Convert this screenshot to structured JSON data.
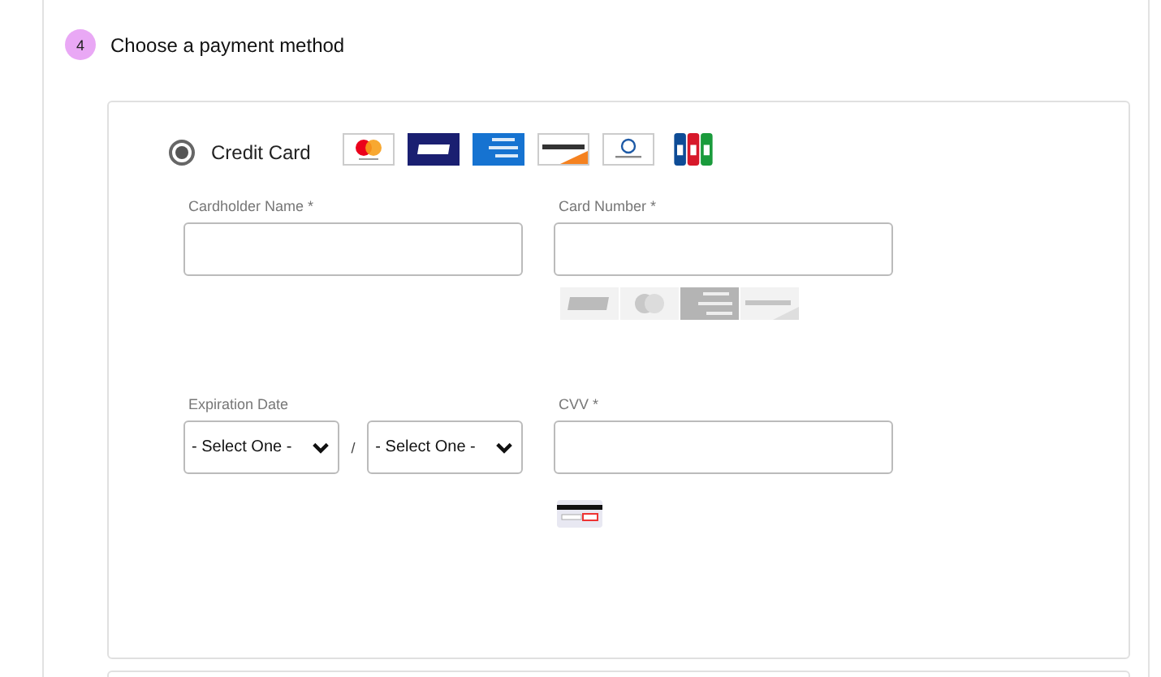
{
  "step": {
    "number": "4",
    "title": "Choose a payment method"
  },
  "payment_method": {
    "label": "Credit Card",
    "selected": true
  },
  "cardholder_name": {
    "label": "Cardholder Name *"
  },
  "card_number": {
    "label": "Card Number *"
  },
  "expiration": {
    "label": "Expiration Date",
    "separator": "/",
    "selects": [
      {
        "value": "- Select One -"
      },
      {
        "value": "- Select One -"
      }
    ]
  },
  "cvv": {
    "label": "CVV *"
  }
}
